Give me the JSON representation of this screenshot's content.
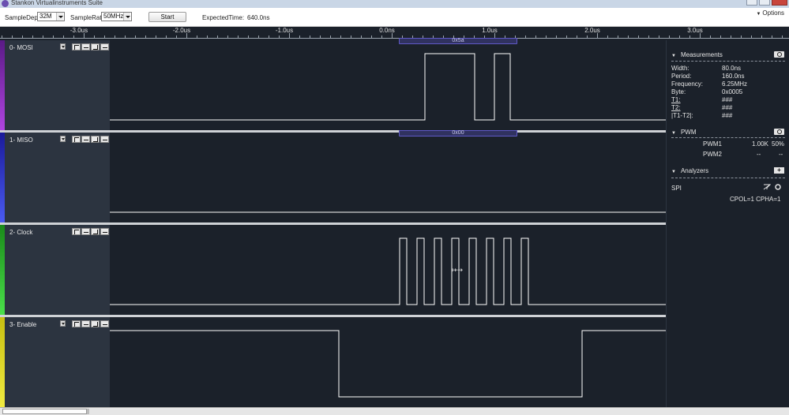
{
  "window": {
    "title": "Stankon Virtualinstruments Suite"
  },
  "toolbar": {
    "sample_depth_label": "SampleDepth",
    "sample_depth_value": "32M",
    "sample_rate_label": "SampleRate",
    "sample_rate_value": "50MHz",
    "start_label": "Start",
    "expected_time_label": "ExpectedTime:",
    "expected_time_value": "640.0ns",
    "options_label": "Options"
  },
  "ruler": {
    "labels": [
      "-3.0us",
      "-2.0us",
      "-1.0us",
      "0.0ns",
      "1.0us",
      "2.0us",
      "3.0us"
    ],
    "values_us": [
      -3.0,
      -2.0,
      -1.0,
      0.0,
      1.0,
      2.0,
      3.0
    ]
  },
  "channels": [
    {
      "name": "0- MOSI",
      "color": "#8e2fb5",
      "decode": "0x5a"
    },
    {
      "name": "1- MISO",
      "color": "#2e2fd0",
      "decode": "0x00"
    },
    {
      "name": "2- Clock",
      "color": "#2fb42f",
      "decode": ""
    },
    {
      "name": "3- Enable",
      "color": "#d8d01a",
      "decode": ""
    }
  ],
  "measurements": {
    "title": "Measurements",
    "rows": [
      {
        "label": "Width:",
        "value": "80.0ns"
      },
      {
        "label": "Period:",
        "value": "160.0ns"
      },
      {
        "label": "Frequency:",
        "value": "6.25MHz"
      },
      {
        "label": "Byte:",
        "value": "0x0005"
      },
      {
        "label": "T1:",
        "value": "###"
      },
      {
        "label": "T2:",
        "value": "###"
      },
      {
        "label": "|T1-T2|:",
        "value": "###"
      }
    ]
  },
  "pwm": {
    "title": "PWM",
    "rows": [
      {
        "name": "PWM1",
        "freq": "1.00K",
        "duty": "50%"
      },
      {
        "name": "PWM2",
        "freq": "--",
        "duty": "--"
      }
    ]
  },
  "analyzers": {
    "title": "Analyzers",
    "spi_name": "SPI",
    "spi_config": "CPOL=1 CPHA=1"
  }
}
